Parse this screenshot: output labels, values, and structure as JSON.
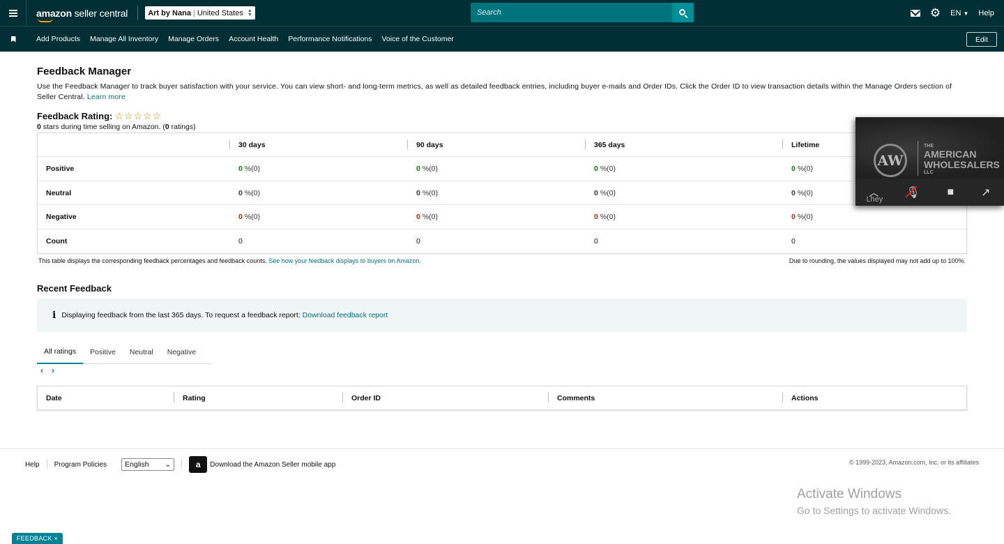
{
  "header": {
    "logo_text_bold": "amazon",
    "logo_text": " seller central",
    "store_name": "Art by Nana",
    "store_region": "United States",
    "search_placeholder": "Search",
    "language": "EN",
    "help": "Help"
  },
  "nav": {
    "items": [
      "Add Products",
      "Manage All Inventory",
      "Manage Orders",
      "Account Health",
      "Performance Notifications",
      "Voice of the Customer"
    ],
    "edit": "Edit"
  },
  "page": {
    "title": "Feedback Manager",
    "intro": "Use the Feedback Manager to track buyer satisfaction with your service. You can view short- and long-term metrics, as well as detailed feedback entries, including buyer e-mails and Order IDs. Click the Order ID to view transaction details within the Manage Orders section of Seller Central.",
    "learn_more": "Learn more",
    "rating_label": "Feedback Rating:",
    "stars": "☆☆☆☆☆",
    "rating_stars_count": "0",
    "rating_sub_mid": " stars during time selling on Amazon. (",
    "rating_count": "0",
    "rating_sub_end": " ratings)"
  },
  "metrics": {
    "columns": [
      "30 days",
      "90 days",
      "365 days",
      "Lifetime"
    ],
    "rows": [
      {
        "label": "Positive",
        "values": [
          "0",
          "0",
          "0",
          "0"
        ],
        "suffix": "%(0)"
      },
      {
        "label": "Neutral",
        "values": [
          "0",
          "0",
          "0",
          "0"
        ],
        "suffix": "%(0)"
      },
      {
        "label": "Negative",
        "values": [
          "0",
          "0",
          "0",
          "0"
        ],
        "suffix": "%(0)"
      },
      {
        "label": "Count",
        "values": [
          "0",
          "0",
          "0",
          "0"
        ],
        "suffix": ""
      }
    ],
    "note_left": "This table displays the corresponding feedback percentages and feedback counts.",
    "note_link": "See how your feedback displays to buyers on Amazon.",
    "note_right": "Due to rounding, the values displayed may not add up to 100%."
  },
  "recent": {
    "title": "Recent Feedback",
    "info_text": "Displaying feedback from the last 365 days. To request a feedback report:",
    "info_link": "Download feedback report",
    "tabs": [
      "All ratings",
      "Positive",
      "Neutral",
      "Negative"
    ],
    "table_headers": [
      "Date",
      "Rating",
      "Order ID",
      "Comments",
      "Actions"
    ]
  },
  "footer": {
    "help": "Help",
    "policies": "Program Policies",
    "language": "English",
    "app_text": "Download the Amazon Seller mobile app",
    "copyright": "© 1999-2023, Amazon.com, Inc. or its affiliates"
  },
  "overlay": {
    "brand_small": "THE",
    "brand_line1": "AMERICAN",
    "brand_line2": "WHOLESALERS",
    "brand_small2": "LLC",
    "logo_letters": "AW",
    "caret_label": "Lhey"
  },
  "windows": {
    "line1": "Activate Windows",
    "line2": "Go to Settings to activate Windows."
  },
  "feedback_tab": "FEEDBACK ×"
}
